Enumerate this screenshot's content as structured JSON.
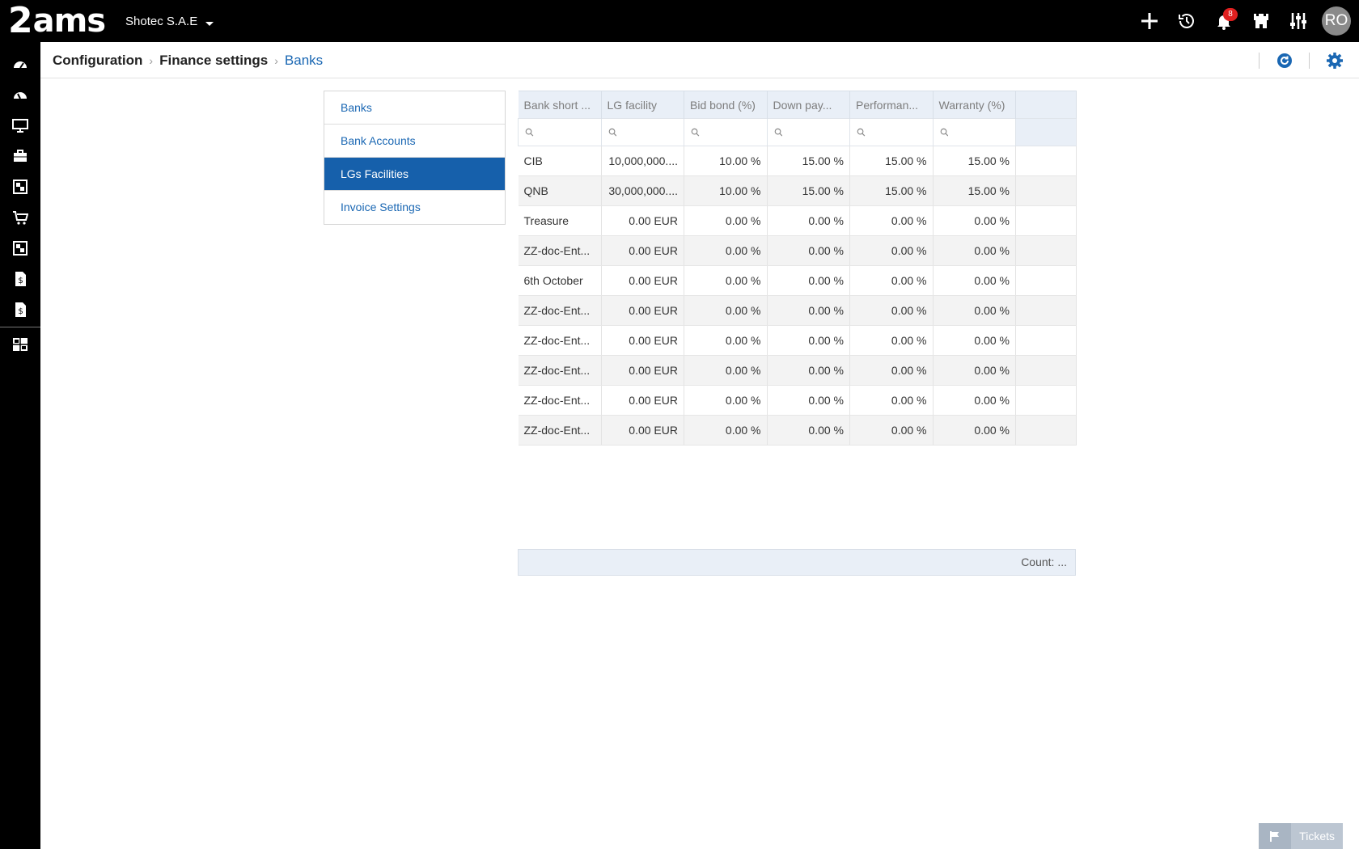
{
  "app": {
    "logo_mark": "2",
    "logo_text": "ams",
    "company": "Shotec S.A.E",
    "notification_count": "8",
    "user_initials": "RO"
  },
  "top_icons": [
    "plus-icon",
    "history-icon",
    "bell-icon",
    "castle-icon",
    "sliders-icon"
  ],
  "left_nav": [
    "dashboard-icon",
    "dashboard-icon",
    "monitor-icon",
    "briefcase-icon",
    "module-icon",
    "cart-icon",
    "module-icon",
    "invoice-icon",
    "invoice-icon",
    "report-icon"
  ],
  "breadcrumb": {
    "items": [
      "Configuration",
      "Finance settings",
      "Banks"
    ]
  },
  "side_menu": {
    "items": [
      "Banks",
      "Bank Accounts",
      "LGs Facilities",
      "Invoice Settings"
    ],
    "selected": "LGs Facilities"
  },
  "grid": {
    "columns": [
      "Bank short ...",
      "LG facility",
      "Bid bond (%)",
      "Down pay...",
      "Performan...",
      "Warranty (%)"
    ],
    "rows": [
      [
        "CIB",
        "10,000,000....",
        "10.00 %",
        "15.00 %",
        "15.00 %",
        "15.00 %"
      ],
      [
        "QNB",
        "30,000,000....",
        "10.00 %",
        "15.00 %",
        "15.00 %",
        "15.00 %"
      ],
      [
        "Treasure",
        "0.00 EUR",
        "0.00 %",
        "0.00 %",
        "0.00 %",
        "0.00 %"
      ],
      [
        "ZZ-doc-Ent...",
        "0.00 EUR",
        "0.00 %",
        "0.00 %",
        "0.00 %",
        "0.00 %"
      ],
      [
        "6th October",
        "0.00 EUR",
        "0.00 %",
        "0.00 %",
        "0.00 %",
        "0.00 %"
      ],
      [
        "ZZ-doc-Ent...",
        "0.00 EUR",
        "0.00 %",
        "0.00 %",
        "0.00 %",
        "0.00 %"
      ],
      [
        "ZZ-doc-Ent...",
        "0.00 EUR",
        "0.00 %",
        "0.00 %",
        "0.00 %",
        "0.00 %"
      ],
      [
        "ZZ-doc-Ent...",
        "0.00 EUR",
        "0.00 %",
        "0.00 %",
        "0.00 %",
        "0.00 %"
      ],
      [
        "ZZ-doc-Ent...",
        "0.00 EUR",
        "0.00 %",
        "0.00 %",
        "0.00 %",
        "0.00 %"
      ],
      [
        "ZZ-doc-Ent...",
        "0.00 EUR",
        "0.00 %",
        "0.00 %",
        "0.00 %",
        "0.00 %"
      ]
    ],
    "footer": "Count: ..."
  },
  "tickets": {
    "label": "Tickets"
  },
  "colors": {
    "accent": "#1a67b3",
    "selected_bg": "#1660ab",
    "header_bg": "#e9eff7",
    "badge": "#e02020"
  }
}
